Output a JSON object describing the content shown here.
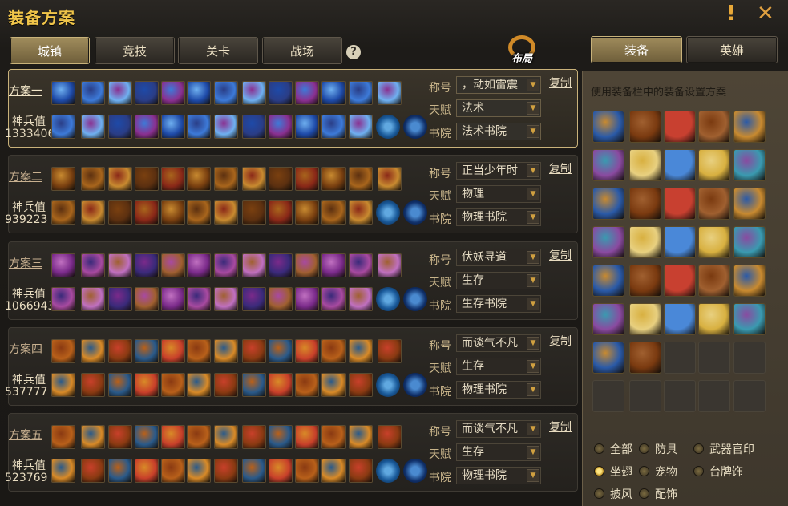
{
  "title": "装备方案",
  "top_tabs": [
    {
      "label": "城镇"
    },
    {
      "label": "竞技"
    },
    {
      "label": "关卡"
    },
    {
      "label": "战场"
    }
  ],
  "help_glyph": "?",
  "layout_button": "布局",
  "right_tabs": [
    {
      "label": "装备"
    },
    {
      "label": "英雄"
    }
  ],
  "field_labels": {
    "title": "称号",
    "talent": "天赋",
    "academy": "书院"
  },
  "power_label": "神兵值",
  "copy_label": "复制",
  "schemes": [
    {
      "name": "方案一",
      "power": "1333406",
      "title": "，动如雷震",
      "talent": "法术",
      "academy": "法术书院",
      "palette": [
        "#1e4aa8",
        "#3d7ad8",
        "#6fb0f0",
        "#2a3d86",
        "#8a3090"
      ]
    },
    {
      "name": "方案二",
      "power": "939223",
      "title": "正当少年时",
      "talent": "物理",
      "academy": "物理书院",
      "palette": [
        "#7a4010",
        "#a8651c",
        "#c88a30",
        "#5c3010",
        "#8a2818"
      ]
    },
    {
      "name": "方案三",
      "power": "1066943",
      "title": "伏妖寻道",
      "talent": "生存",
      "academy": "生存书院",
      "palette": [
        "#7a2a8a",
        "#a84aa0",
        "#c070c0",
        "#3a2a7a",
        "#a06030"
      ]
    },
    {
      "name": "方案四",
      "power": "537777",
      "title": "而谈气不凡",
      "talent": "生存",
      "academy": "物理书院",
      "palette": [
        "#b8601a",
        "#d88a28",
        "#8a3a12",
        "#2a5a8a",
        "#c8402a"
      ]
    },
    {
      "name": "方案五",
      "power": "523769",
      "title": "而谈气不凡",
      "talent": "生存",
      "academy": "物理书院",
      "palette": [
        "#b8601a",
        "#d88a28",
        "#8a3a12",
        "#2a5a8a",
        "#c8402a"
      ]
    }
  ],
  "panel_hint": "使用装备栏中的装备设置方案",
  "palette_colors": [
    "#2a5aa8",
    "#4a88d8",
    "#c88a30",
    "#7a3a10",
    "#d8b040",
    "#8a4aa0",
    "#c84030",
    "#3a9ab0",
    "#e8d080",
    "#a06030"
  ],
  "filters": [
    {
      "label": "全部",
      "selected": false
    },
    {
      "label": "防具",
      "selected": false
    },
    {
      "label": "武器官印",
      "selected": false
    },
    {
      "label": "坐翅",
      "selected": true
    },
    {
      "label": "宠物",
      "selected": false
    },
    {
      "label": "台牌饰",
      "selected": false
    },
    {
      "label": "披风",
      "selected": false
    },
    {
      "label": "配饰",
      "selected": false
    }
  ]
}
